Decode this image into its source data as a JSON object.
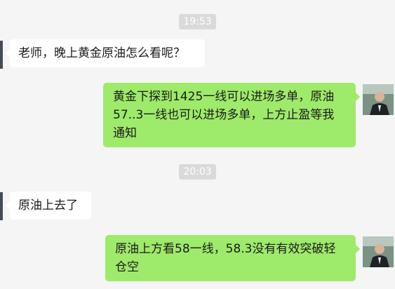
{
  "messages": {
    "ts1": "19:53",
    "m1": "老师，晚上黄金原油怎么看呢？",
    "m2": "黄金下探到1425一线可以进场多单，原油57..3一线也可以进场多单，上方止盈等我通知",
    "ts2": "20:03",
    "m3": "原油上去了",
    "m4": "原油上方看58一线，58.3没有有效突破轻仓空"
  },
  "colors": {
    "background": "#f5f5f5",
    "bubble_sent": "#9eea6a",
    "bubble_received": "#ffffff",
    "timestamp_bg": "#dadada"
  }
}
